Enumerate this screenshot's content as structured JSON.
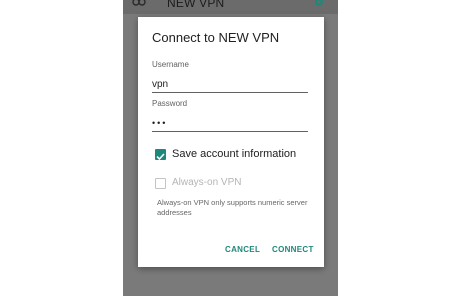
{
  "topbar": {
    "title": "NEW VPN",
    "left_icon": "vpn-key-icon",
    "right_icon": "gear-icon"
  },
  "dialog": {
    "title": "Connect to NEW VPN",
    "username_label": "Username",
    "username_value": "vpn",
    "password_label": "Password",
    "password_value": "•••",
    "save_account_label": "Save account information",
    "save_account_checked": true,
    "always_on_label": "Always-on VPN",
    "always_on_checked": false,
    "always_on_hint": "Always-on VPN only supports numeric server addresses",
    "cancel_label": "CANCEL",
    "connect_label": "CONNECT"
  },
  "colors": {
    "accent": "#1e887a",
    "dim_background": "#7a7a7a",
    "disabled_text": "#b5b5b5"
  }
}
